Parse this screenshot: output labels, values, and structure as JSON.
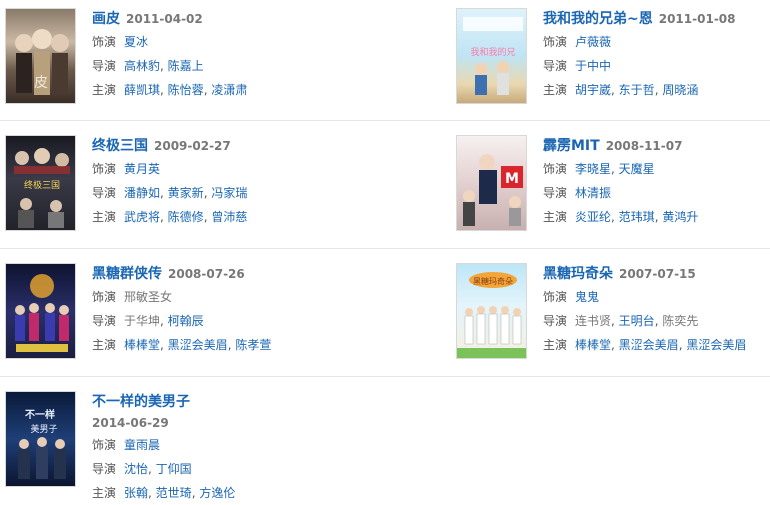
{
  "labels": {
    "role": "饰演",
    "director": "导演",
    "cast": "主演"
  },
  "items": [
    {
      "title": "画皮",
      "date": "2011-04-02",
      "role": [
        "夏冰"
      ],
      "director": [
        "高林豹",
        "陈嘉上"
      ],
      "cast": [
        "薛凯琪",
        "陈怡蓉",
        "凌潇肃"
      ]
    },
    {
      "title": "我和我的兄弟~恩",
      "date": "2011-01-08",
      "role": [
        "卢薇薇"
      ],
      "director": [
        "于中中"
      ],
      "cast": [
        "胡宇崴",
        "东于哲",
        "周晓涵"
      ]
    },
    {
      "title": "终极三国",
      "date": "2009-02-27",
      "role": [
        "黄月英"
      ],
      "director": [
        "潘静如",
        "黄家新",
        "冯家瑞"
      ],
      "cast": [
        "武虎将",
        "陈德修",
        "曾沛慈"
      ]
    },
    {
      "title": "霹雳MIT",
      "date": "2008-11-07",
      "role": [
        "李晓星",
        "天魔星"
      ],
      "director": [
        "林清振"
      ],
      "cast": [
        "炎亚纶",
        "范玮琪",
        "黄鸿升"
      ]
    },
    {
      "title": "黑糖群侠传",
      "date": "2008-07-26",
      "role": [
        "邢敏圣女"
      ],
      "director": [
        "于华坤",
        "柯翰辰"
      ],
      "cast": [
        "棒棒堂",
        "黑涩会美眉",
        "陈孝萱"
      ]
    },
    {
      "title": "黑糖玛奇朵",
      "date": "2007-07-15",
      "role": [
        "鬼鬼"
      ],
      "director": [
        "连书贤",
        "王明台",
        "陈奕先"
      ],
      "cast": [
        "棒棒堂",
        "黑涩会美眉",
        "黑涩会美眉"
      ]
    },
    {
      "title": "不一样的美男子",
      "date": "2014-06-29",
      "role": [
        "童雨晨"
      ],
      "director": [
        "沈怡",
        "丁仰国"
      ],
      "cast": [
        "张翰",
        "范世琦",
        "方逸伦"
      ]
    }
  ]
}
